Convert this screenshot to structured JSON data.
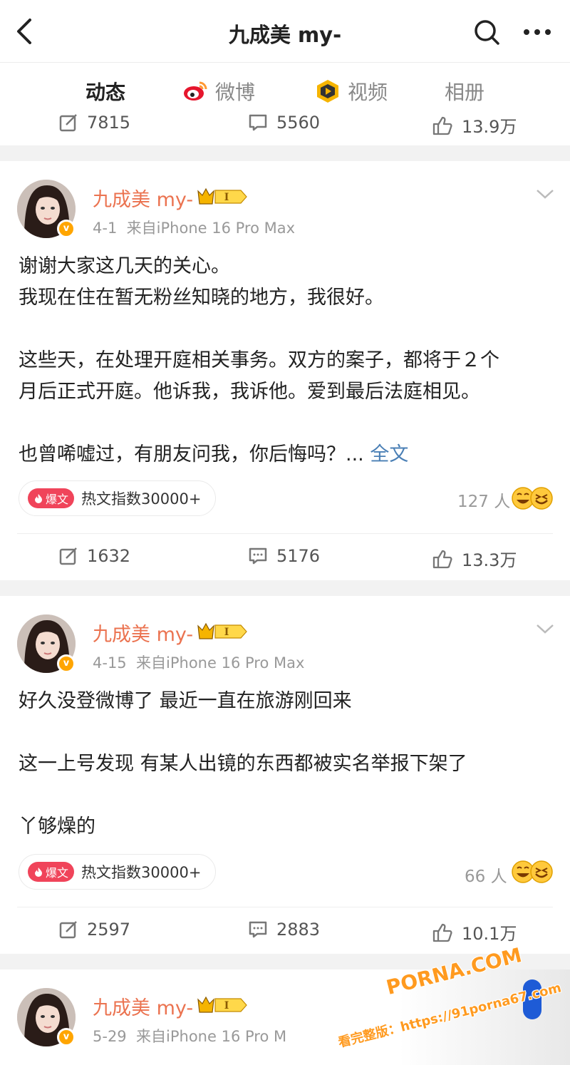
{
  "header": {
    "title": "九成美 my-"
  },
  "tabs": [
    {
      "label": "动态",
      "icon": "none",
      "active": true
    },
    {
      "label": "微博",
      "icon": "weibo-logo-icon"
    },
    {
      "label": "视频",
      "icon": "video-play-icon"
    },
    {
      "label": "相册",
      "icon": "none"
    }
  ],
  "previous_post_stats": {
    "reposts": "7815",
    "comments": "5560",
    "likes": "13.9万"
  },
  "posts": [
    {
      "author": "九成美 my-",
      "vip_label": "I",
      "verified_badge": "v",
      "date": "4-1",
      "source": "来自iPhone 16 Pro Max",
      "lines": [
        "谢谢大家这几天的关心。",
        "我现在住在暂无粉丝知晓的地方，我很好。",
        "",
        "这些天，在处理开庭相关事务。双方的案子，都将于２个",
        "月后正式开庭。他诉我，我诉他。爱到最后法庭相见。",
        "",
        "也曾唏嘘过，有朋友问我，你后悔吗？..."
      ],
      "full_text_link": "全文",
      "hot_badge": "爆文",
      "hot_index": "热文指数30000+",
      "reaction_count": "127 人",
      "reposts": "1632",
      "comments": "5176",
      "likes": "13.3万"
    },
    {
      "author": "九成美 my-",
      "vip_label": "I",
      "verified_badge": "v",
      "date": "4-15",
      "source": "来自iPhone 16 Pro Max",
      "lines": [
        "好久没登微博了 最近一直在旅游刚回来",
        "",
        "这一上号发现 有某人出镜的东西都被实名举报下架了",
        "",
        "丫够燥的"
      ],
      "hot_badge": "爆文",
      "hot_index": "热文指数30000+",
      "reaction_count": "66 人",
      "reposts": "2597",
      "comments": "2883",
      "likes": "10.1万"
    },
    {
      "author": "九成美 my-",
      "vip_label": "I",
      "verified_badge": "v",
      "date": "5-29",
      "source": "来自iPhone 16 Pro M"
    }
  ],
  "watermark": {
    "brand": "PORNA.COM",
    "url_text": "看完整版：https://91porna67.com"
  },
  "colors": {
    "accent": "#ff8200",
    "username": "#eb7350",
    "link": "#4a7fb5",
    "hot": "#f0445a"
  }
}
